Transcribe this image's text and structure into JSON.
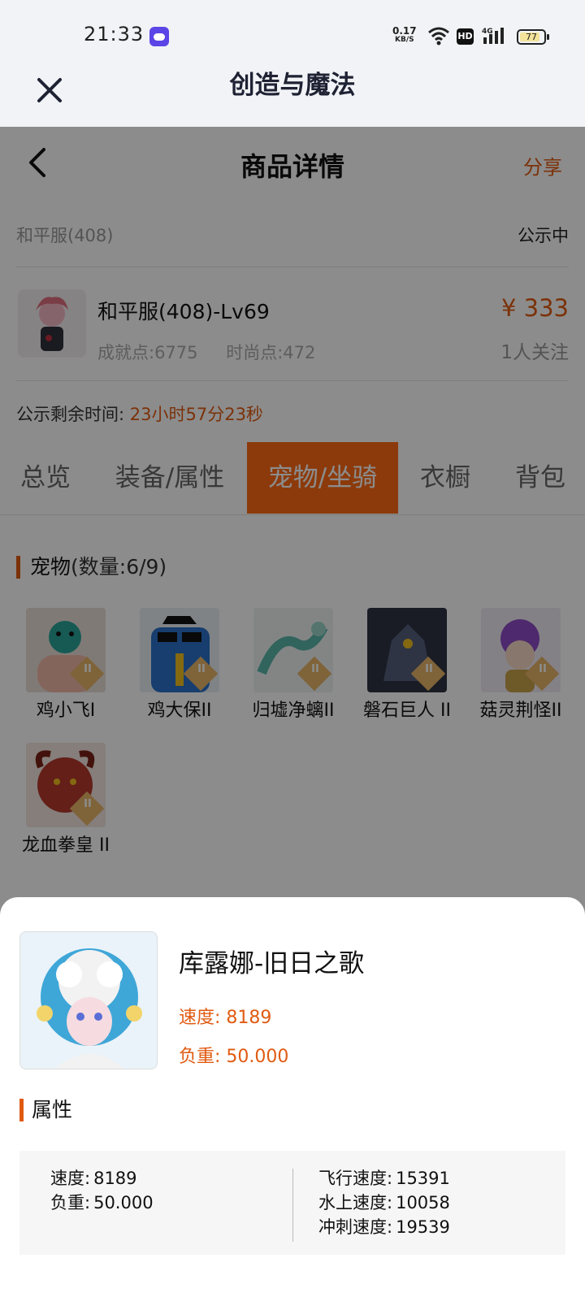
{
  "status_bar": {
    "time": "21:33",
    "net_speed": "0.17",
    "net_unit": "KB/S",
    "hd": "HD",
    "net_type": "4G",
    "battery": "77"
  },
  "app_header": {
    "title": "创造与魔法",
    "close_icon": "close-icon"
  },
  "nav": {
    "title": "商品详情",
    "share": "分享",
    "back_icon": "chevron-left-icon"
  },
  "listing": {
    "server": "和平服(408)",
    "status": "公示中",
    "character_name": "和平服(408)-Lv69",
    "achievement": "成就点:6775",
    "fashion": "时尚点:472",
    "price": "¥ 333",
    "followers": "1人关注",
    "remaining_label": "公示剩余时间:",
    "remaining_time": "23小时57分23秒"
  },
  "tabs": [
    {
      "label": "总览",
      "active": false
    },
    {
      "label": "装备/属性",
      "active": false
    },
    {
      "label": "宠物/坐骑",
      "active": true
    },
    {
      "label": "衣橱",
      "active": false
    },
    {
      "label": "背包",
      "active": false
    }
  ],
  "pets": {
    "title": "宠物",
    "count": "(数量:6/9)",
    "items": [
      {
        "name": "鸡小飞I",
        "grade": "I"
      },
      {
        "name": "鸡大保II",
        "grade": "II"
      },
      {
        "name": "归墟净螭II",
        "grade": "II"
      },
      {
        "name": "磐石巨人 II",
        "grade": "II"
      },
      {
        "name": "菇灵荆怪II",
        "grade": "II"
      },
      {
        "name": "龙血拳皇 II",
        "grade": "II"
      }
    ]
  },
  "sheet": {
    "mount_name": "库露娜-旧日之歌",
    "speed": "速度: 8189",
    "load": "负重: 50.000",
    "attr_title": "属性",
    "attributes_left": [
      {
        "label": "速度:",
        "value": "8189"
      },
      {
        "label": "负重:",
        "value": "50.000"
      }
    ],
    "attributes_right": [
      {
        "label": "飞行速度:",
        "value": "15391"
      },
      {
        "label": "水上速度:",
        "value": "10058"
      },
      {
        "label": "冲刺速度:",
        "value": "19539"
      }
    ]
  },
  "colors": {
    "accent": "#e05b12",
    "tab_active": "#ff6a14",
    "overlay": "rgba(0,0,0,0.45)"
  }
}
